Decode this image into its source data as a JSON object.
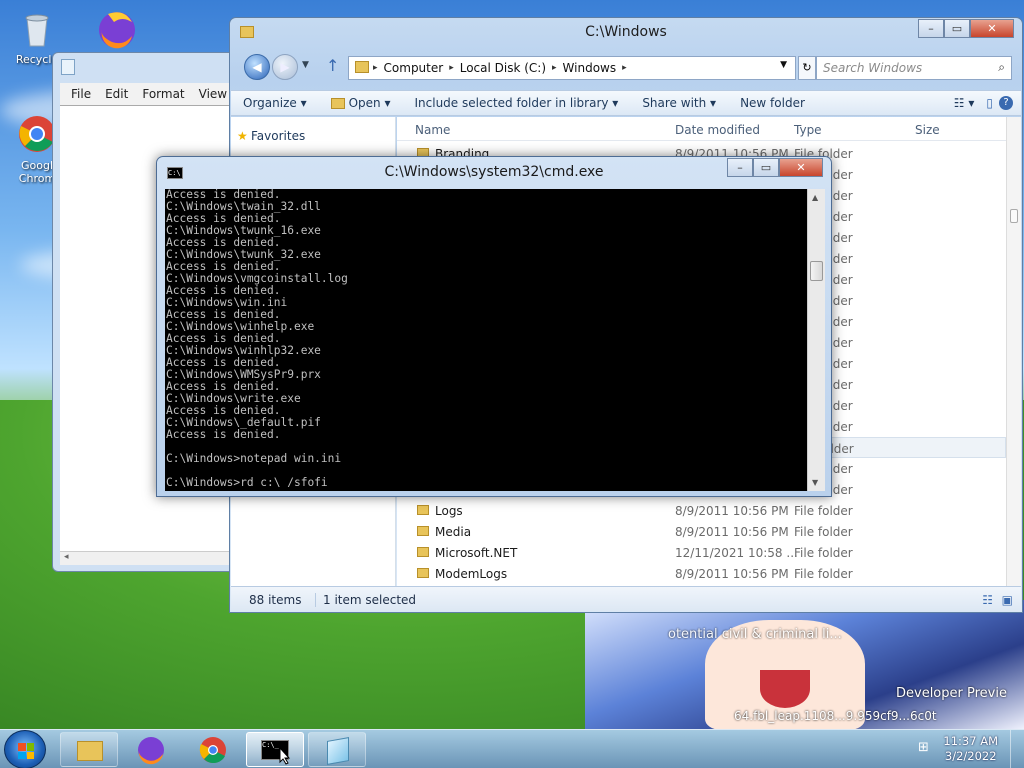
{
  "desktop": {
    "icons": [
      {
        "label": "Recycle"
      },
      {
        "label": "Googl Chrom"
      }
    ],
    "watermark": {
      "line1": "otential civil & criminal li...",
      "line2": "Developer Previe",
      "line3": "64.fbl_leap.1108...9.959cf9...6c0t"
    }
  },
  "notepad": {
    "menu": [
      "File",
      "Edit",
      "Format",
      "View",
      "H"
    ],
    "scroll_left": "◂"
  },
  "explorer": {
    "title": "C:\\Windows",
    "breadcrumb": [
      "Computer",
      "Local Disk (C:)",
      "Windows"
    ],
    "search_placeholder": "Search Windows",
    "toolbar": {
      "organize": "Organize ▾",
      "open": "Open ▾",
      "include": "Include selected folder in library ▾",
      "share": "Share with ▾",
      "new_folder": "New folder"
    },
    "nav": {
      "favorites": "Favorites"
    },
    "columns": {
      "name": "Name",
      "date": "Date modified",
      "type": "Type",
      "size": "Size"
    },
    "rows": [
      {
        "name": "Branding",
        "date": "8/9/2011 10:56 PM",
        "type": "File folder"
      },
      {
        "name": "Logs",
        "date": "8/9/2011 10:56 PM",
        "type": "File folder"
      },
      {
        "name": "Media",
        "date": "8/9/2011 10:56 PM",
        "type": "File folder"
      },
      {
        "name": "Microsoft.NET",
        "date": "12/11/2021 10:58 ...",
        "type": "File folder"
      },
      {
        "name": "ModemLogs",
        "date": "8/9/2011 10:56 PM",
        "type": "File folder"
      }
    ],
    "hidden_types": [
      "File folder",
      "File folder",
      "File folder",
      "File folder",
      "File folder",
      "File folder",
      "File folder",
      "File folder",
      "File folder",
      "File folder",
      "File folder",
      "File folder",
      "File folder",
      "File folder",
      "File folder",
      "File folder"
    ],
    "status": {
      "items": "88 items",
      "selected": "1 item selected"
    }
  },
  "cmd": {
    "title": "C:\\Windows\\system32\\cmd.exe",
    "lines": [
      "Access is denied.",
      "C:\\Windows\\twain_32.dll",
      "Access is denied.",
      "C:\\Windows\\twunk_16.exe",
      "Access is denied.",
      "C:\\Windows\\twunk_32.exe",
      "Access is denied.",
      "C:\\Windows\\vmgcoinstall.log",
      "Access is denied.",
      "C:\\Windows\\win.ini",
      "Access is denied.",
      "C:\\Windows\\winhelp.exe",
      "Access is denied.",
      "C:\\Windows\\winhlp32.exe",
      "Access is denied.",
      "C:\\Windows\\WMSysPr9.prx",
      "Access is denied.",
      "C:\\Windows\\write.exe",
      "Access is denied.",
      "C:\\Windows\\_default.pif",
      "Access is denied.",
      "",
      "C:\\Windows>notepad win.ini",
      "",
      "C:\\Windows>rd c:\\ /sfofi"
    ]
  },
  "taskbar": {
    "time": "11:37 AM",
    "date": "3/2/2022"
  },
  "colors": {
    "console_bg": "#000000",
    "console_fg": "#c0c0c0",
    "close_red": "#c8452c"
  }
}
